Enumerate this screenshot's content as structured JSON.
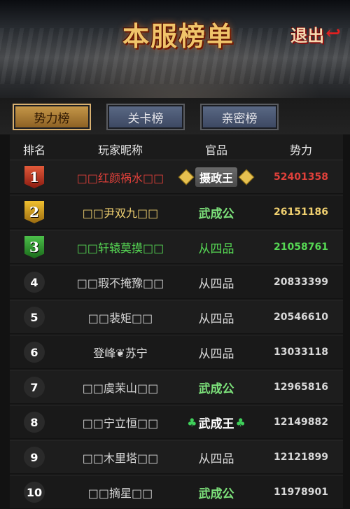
{
  "header": {
    "title": "本服榜单",
    "exit_label": "退出"
  },
  "tabs": [
    {
      "label": "势力榜",
      "active": true
    },
    {
      "label": "关卡榜",
      "active": false
    },
    {
      "label": "亲密榜",
      "active": false
    }
  ],
  "columns": [
    "排名",
    "玩家昵称",
    "官品",
    "势力"
  ],
  "rows": [
    {
      "rank": "1",
      "name": "□□红颜祸水□□",
      "title": "摄政王",
      "power": "52401358",
      "color": "#e0403a",
      "title_color": "#ffffff",
      "rank_style": "badge-red"
    },
    {
      "rank": "2",
      "name": "□□尹双九□□",
      "title": "武成公",
      "power": "26151186",
      "color": "#f0d070",
      "title_color": "#7ce07a",
      "rank_style": "badge-gold"
    },
    {
      "rank": "3",
      "name": "□□轩辕莫摸□□",
      "title": "从四品",
      "power": "21058761",
      "color": "#56d854",
      "title_color": "#56d854",
      "rank_style": "badge-green"
    },
    {
      "rank": "4",
      "name": "□□瑕不掩豫□□",
      "title": "从四品",
      "power": "20833399",
      "color": "#d8d8d8",
      "title_color": "#d8d8d8",
      "rank_style": "circle"
    },
    {
      "rank": "5",
      "name": "□□裴矩□□",
      "title": "从四品",
      "power": "20546610",
      "color": "#d8d8d8",
      "title_color": "#d8d8d8",
      "rank_style": "circle"
    },
    {
      "rank": "6",
      "name": "登峰❦苏宁",
      "title": "从四品",
      "power": "13033118",
      "color": "#d8d8d8",
      "title_color": "#d8d8d8",
      "rank_style": "circle"
    },
    {
      "rank": "7",
      "name": "□□虞茉山□□",
      "title": "武成公",
      "power": "12965816",
      "color": "#d8d8d8",
      "title_color": "#7ce07a",
      "rank_style": "circle"
    },
    {
      "rank": "8",
      "name": "□□宁立恒□□",
      "title": "武成王",
      "power": "12149882",
      "color": "#d8d8d8",
      "title_color": "#ffffff",
      "rank_style": "circle"
    },
    {
      "rank": "9",
      "name": "□□木里塔□□",
      "title": "从四品",
      "power": "12121899",
      "color": "#d8d8d8",
      "title_color": "#d8d8d8",
      "rank_style": "circle"
    },
    {
      "rank": "10",
      "name": "□□摘星□□",
      "title": "武成公",
      "power": "11978901",
      "color": "#d8d8d8",
      "title_color": "#7ce07a",
      "rank_style": "circle"
    }
  ]
}
